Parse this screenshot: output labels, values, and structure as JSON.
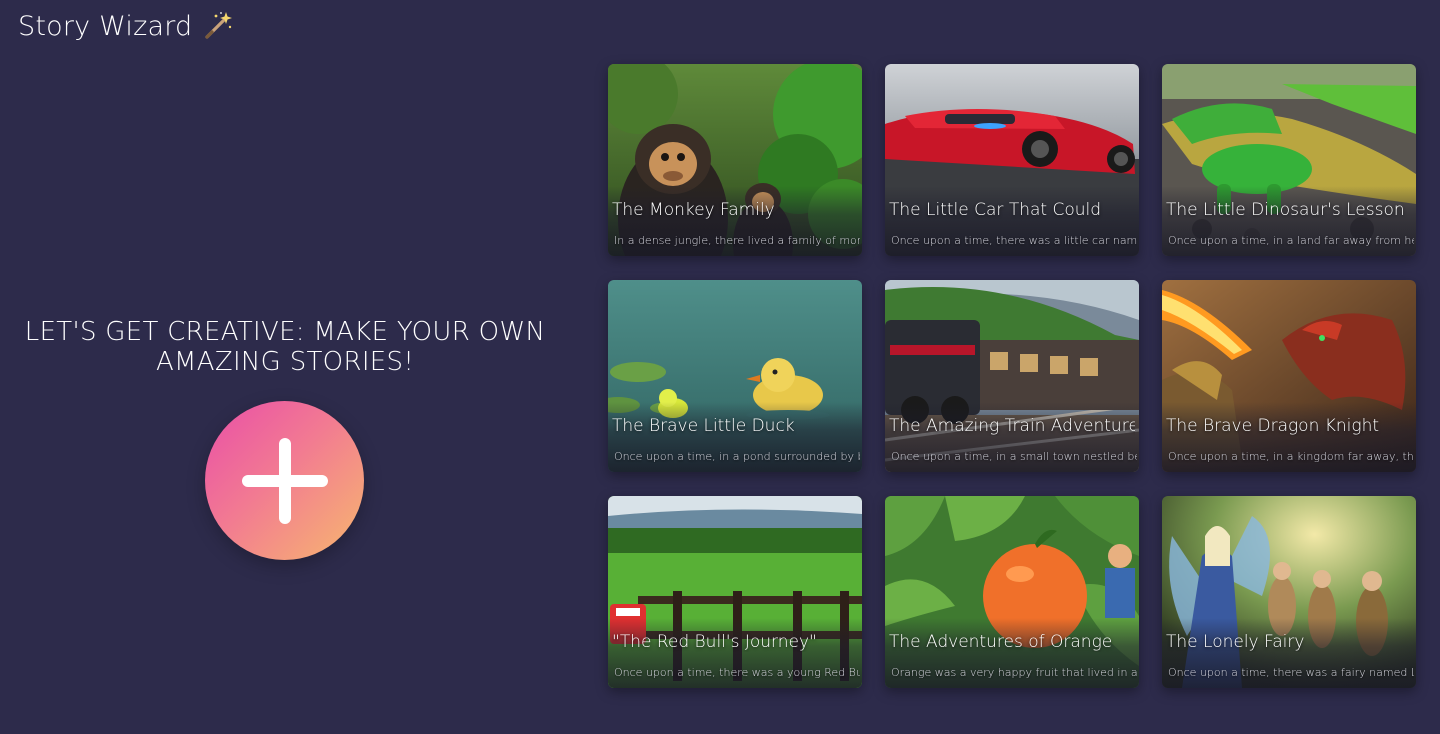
{
  "header": {
    "title": "Story Wizard",
    "icon": "magic-wand-icon"
  },
  "hero": {
    "heading_line1": "LET'S GET CREATIVE: MAKE YOUR OWN",
    "heading_line2": "AMAZING STORIES!",
    "create_icon": "plus-icon",
    "gradient": [
      "#e94ea8",
      "#f7b86e"
    ]
  },
  "colors": {
    "background": "#2d2b4b",
    "text": "#ffffff"
  },
  "stories": [
    {
      "title": "The Monkey Family",
      "snippet": "In a dense jungle, there lived a family of monkeys"
    },
    {
      "title": "The Little Car That Could",
      "snippet": "Once upon a time, there was a little car named"
    },
    {
      "title": "The Little Dinosaur's Lesson",
      "snippet": "Once upon a time, in a land far away from here"
    },
    {
      "title": "The Brave Little Duck",
      "snippet": "Once upon a time, in a pond surrounded by be"
    },
    {
      "title": "The Amazing Train Adventure",
      "snippet": "Once upon a time, in a small town nestled betw"
    },
    {
      "title": "The Brave Dragon Knight",
      "snippet": "Once upon a time, in a kingdom far away, there"
    },
    {
      "title": "\"The Red Bull's Journey\"",
      "snippet": "Once upon a time, there was a young Red Bull n"
    },
    {
      "title": "The Adventures of Orange",
      "snippet": "Orange was a very happy fruit that lived in a b"
    },
    {
      "title": "The Lonely Fairy",
      "snippet": "Once upon a time, there was a fairy named Lily"
    }
  ]
}
